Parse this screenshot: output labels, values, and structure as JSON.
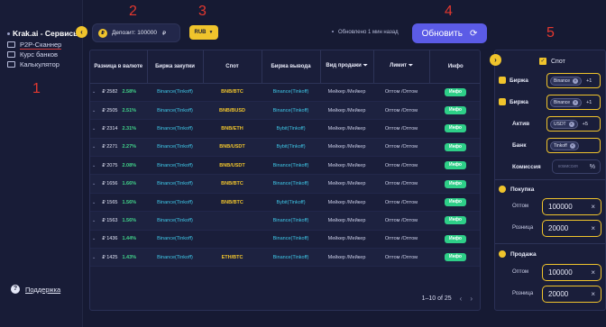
{
  "sidebar": {
    "brand": "Krak.ai - Сервисы",
    "items": [
      {
        "label": "P2P-Сканнер",
        "active": true
      },
      {
        "label": "Курс банков",
        "active": false
      },
      {
        "label": "Калькулятор",
        "active": false
      }
    ],
    "support": "Поддержка"
  },
  "annotations": [
    "1",
    "2",
    "3",
    "4",
    "5"
  ],
  "toolbar": {
    "collapse_icon": "chevron-left-icon",
    "deposit_label": "Депозит: 100000",
    "deposit_currency": "₽",
    "currency_select": "RUB",
    "updated_text": "Обновлено 1 мин назад",
    "refresh_label": "Обновить"
  },
  "table": {
    "headers": [
      "Разница в валюте",
      "Биржа закупки",
      "Спот",
      "Биржа вывода",
      "Вид продажи",
      "Лимит",
      "Инфо"
    ],
    "rows": [
      {
        "amount": "₽ 2582",
        "pct": "2.58%",
        "buy": "Binance(Tinkoff)",
        "spot": "BNB/BTC",
        "sell": "Binance(Tinkoff)",
        "type": "Мейкер /Мейкер",
        "limit": "Оптом /Оптом",
        "info": "Инфо"
      },
      {
        "amount": "₽ 2505",
        "pct": "2.51%",
        "buy": "Binance(Tinkoff)",
        "spot": "BNB/BUSD",
        "sell": "Binance(Tinkoff)",
        "type": "Мейкер /Мейкер",
        "limit": "Оптом /Оптом",
        "info": "Инфо"
      },
      {
        "amount": "₽ 2314",
        "pct": "2.31%",
        "buy": "Binance(Tinkoff)",
        "spot": "BNB/ETH",
        "sell": "Bybit(Tinkoff)",
        "type": "Мейкер /Мейкер",
        "limit": "Оптом /Оптом",
        "info": "Инфо"
      },
      {
        "amount": "₽ 2271",
        "pct": "2.27%",
        "buy": "Binance(Tinkoff)",
        "spot": "BNB/USDT",
        "sell": "Bybit(Tinkoff)",
        "type": "Мейкер /Мейкер",
        "limit": "Оптом /Оптом",
        "info": "Инфо"
      },
      {
        "amount": "₽ 2075",
        "pct": "2.08%",
        "buy": "Binance(Tinkoff)",
        "spot": "BNB/USDT",
        "sell": "Binance(Tinkoff)",
        "type": "Мейкер /Мейкер",
        "limit": "Оптом /Оптом",
        "info": "Инфо"
      },
      {
        "amount": "₽ 1656",
        "pct": "1.66%",
        "buy": "Binance(Tinkoff)",
        "spot": "BNB/BTC",
        "sell": "Binance(Tinkoff)",
        "type": "Мейкер /Мейкер",
        "limit": "Оптом /Оптом",
        "info": "Инфо"
      },
      {
        "amount": "₽ 1565",
        "pct": "1.56%",
        "buy": "Binance(Tinkoff)",
        "spot": "BNB/BTC",
        "sell": "Bybit(Tinkoff)",
        "type": "Мейкер /Мейкер",
        "limit": "Оптом /Оптом",
        "info": "Инфо"
      },
      {
        "amount": "₽ 1563",
        "pct": "1.56%",
        "buy": "Binance(Tinkoff)",
        "spot": "",
        "sell": "Binance(Tinkoff)",
        "type": "Мейкер /Мейкер",
        "limit": "Оптом /Оптом",
        "info": "Инфо"
      },
      {
        "amount": "₽ 1436",
        "pct": "1.44%",
        "buy": "Binance(Tinkoff)",
        "spot": "",
        "sell": "Binance(Tinkoff)",
        "type": "Мейкер /Мейкер",
        "limit": "Оптом /Оптом",
        "info": "Инфо"
      },
      {
        "amount": "₽ 1425",
        "pct": "1.43%",
        "buy": "Binance(Tinkoff)",
        "spot": "ETH/BTC",
        "sell": "Binance(Tinkoff)",
        "type": "Мейкер /Мейкер",
        "limit": "Оптом /Оптом",
        "info": "Инфо"
      }
    ],
    "pagination": "1–10 of 25"
  },
  "filters": {
    "spot_label": "Спот",
    "exchange_label": "Биржа",
    "exchange1_chip": "Binance",
    "exchange1_more": "+1",
    "exchange2_label": "Биржа",
    "exchange2_chip": "Binance",
    "exchange2_more": "+1",
    "asset_label": "Актив",
    "asset_chip": "USDT",
    "asset_more": "+5",
    "bank_label": "Банк",
    "bank_chip": "Tinkoff",
    "commission_label": "Комиссия",
    "commission_placeholder": "комиссия",
    "commission_unit": "%",
    "buy_section": "Покупка",
    "buy_bulk_label": "Оптом",
    "buy_bulk_value": "100000",
    "buy_retail_label": "Розница",
    "buy_retail_value": "20000",
    "sell_section": "Продажа",
    "sell_bulk_label": "Оптом",
    "sell_bulk_value": "100000",
    "sell_retail_label": "Розница",
    "sell_retail_value": "20000"
  },
  "colors": {
    "accent": "#f0c42c",
    "primary": "#5b5be6",
    "positive": "#2ecf88",
    "link": "#3fc8e8",
    "annotation": "#e4382f"
  }
}
